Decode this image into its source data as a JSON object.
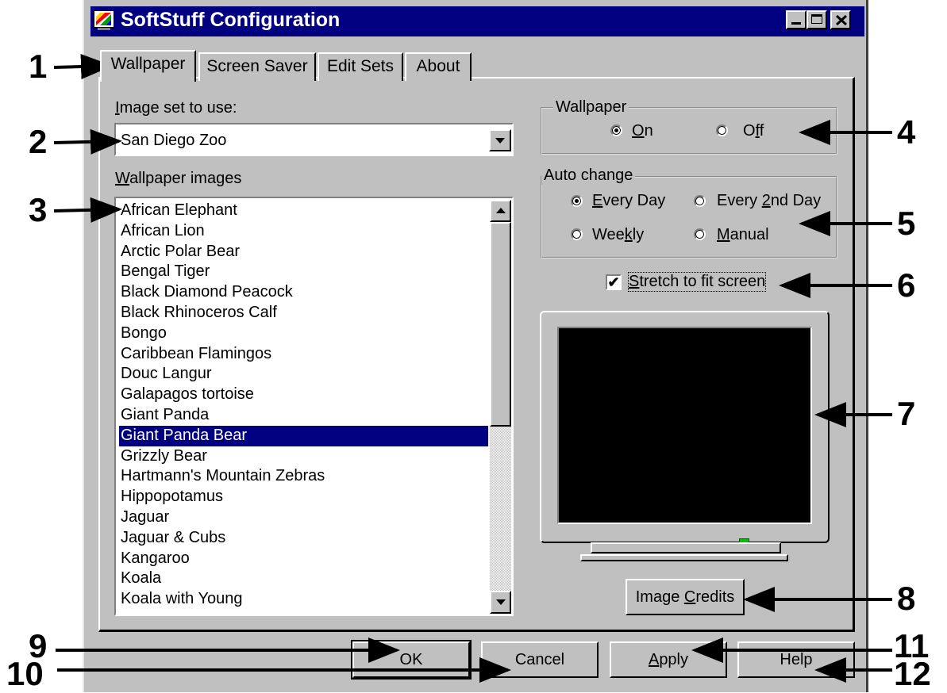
{
  "window": {
    "title": "SoftStuff Configuration"
  },
  "tabs": [
    {
      "label": "Wallpaper",
      "selected": true
    },
    {
      "label": "Screen Saver"
    },
    {
      "label": "Edit Sets"
    },
    {
      "label": "About"
    }
  ],
  "image_set": {
    "label_u": "I",
    "label_rest": "mage set to use:",
    "value": "San Diego Zoo"
  },
  "wallpaper_images": {
    "label_u": "W",
    "label_rest": "allpaper images",
    "items": [
      "African Elephant",
      "African Lion",
      "Arctic Polar Bear",
      "Bengal Tiger",
      "Black Diamond Peacock",
      "Black Rhinoceros Calf",
      "Bongo",
      "Caribbean Flamingos",
      "Douc Langur",
      "Galapagos tortoise",
      "Giant Panda",
      "Giant Panda Bear",
      "Grizzly Bear",
      "Hartmann's Mountain Zebras",
      "Hippopotamus",
      "Jaguar",
      "Jaguar & Cubs",
      "Kangaroo",
      "Koala",
      "Koala with Young"
    ],
    "selected": "Giant Panda Bear"
  },
  "wallpaper_group": {
    "title": "Wallpaper",
    "on_u": "O",
    "on_rest": "n",
    "off_pre": "O",
    "off_u": "f",
    "off_rest": "f",
    "selected": "On"
  },
  "auto_change": {
    "title": "Auto change",
    "every_day_u": "E",
    "every_day_rest": "very Day",
    "every2_pre": "Every ",
    "every2_u": "2",
    "every2_rest": "nd Day",
    "weekly_pre": "Wee",
    "weekly_u": "k",
    "weekly_rest": "ly",
    "manual_u": "M",
    "manual_rest": "anual",
    "selected": "Every Day"
  },
  "stretch": {
    "label_u": "S",
    "label_rest": "tretch to fit screen",
    "checked": true,
    "check_glyph": "✔"
  },
  "buttons": {
    "credits_pre": "Image ",
    "credits_u": "C",
    "credits_rest": "redits",
    "ok": "OK",
    "cancel": "Cancel",
    "apply_u": "A",
    "apply_rest": "pply",
    "help": "Help"
  },
  "caption_buttons": {
    "minimize": "_",
    "maximize": "□",
    "close": "✕"
  },
  "callouts": [
    "1",
    "2",
    "3",
    "4",
    "5",
    "6",
    "7",
    "8",
    "9",
    "10",
    "11",
    "12"
  ],
  "icons": [
    "app-icon",
    "dropdown-arrow-icon",
    "scroll-up-icon",
    "scroll-down-icon",
    "checkmark-icon",
    "monitor-preview-icon"
  ],
  "colors": {
    "titlebar": "#000080",
    "face": "#c0c0c0",
    "selection": "#000080",
    "led": "#00c000"
  }
}
